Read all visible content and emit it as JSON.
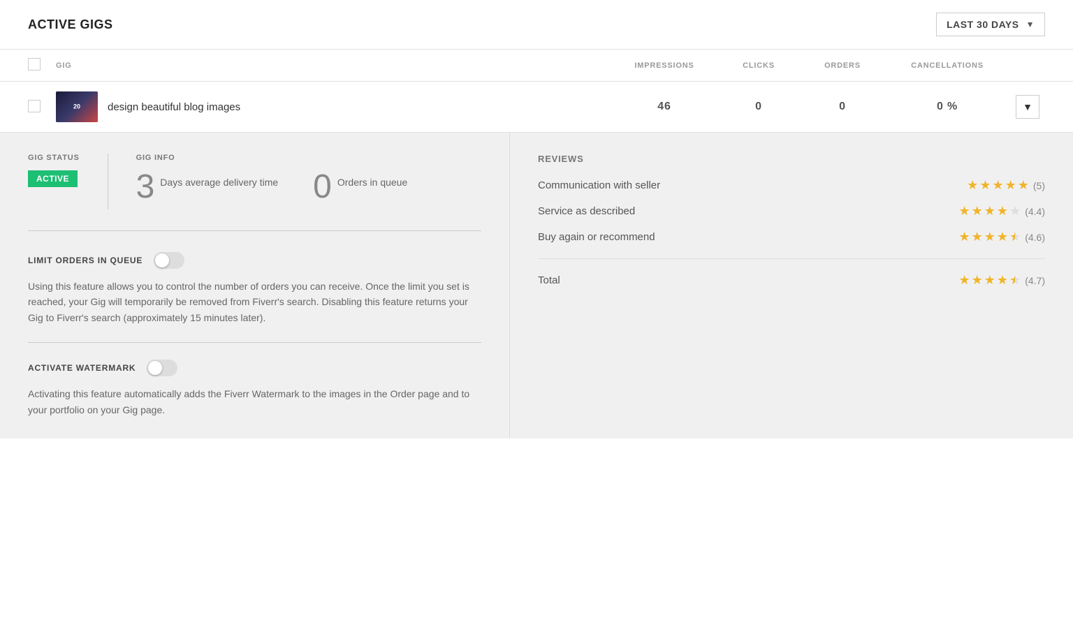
{
  "header": {
    "title": "ACTIVE GIGS",
    "dateFilter": "LAST 30 DAYS"
  },
  "table": {
    "columns": {
      "gig": "GIG",
      "impressions": "IMPRESSIONS",
      "clicks": "CLICKS",
      "orders": "ORDERS",
      "cancellations": "CANCELLATIONS"
    },
    "rows": [
      {
        "id": 1,
        "title": "design beautiful blog images",
        "impressions": "46",
        "clicks": "0",
        "orders": "0",
        "cancellations": "0 %"
      }
    ]
  },
  "detail": {
    "gigStatus": {
      "sectionLabel": "GIG STATUS",
      "statusBadge": "ACTIVE"
    },
    "gigInfo": {
      "sectionLabel": "GIG INFO",
      "deliveryNumber": "3",
      "deliveryDesc": "Days average delivery time",
      "ordersNumber": "0",
      "ordersDesc": "Orders in queue"
    },
    "limitOrders": {
      "label": "LIMIT ORDERS IN QUEUE",
      "description": "Using this feature allows you to control the number of orders you can receive. Once the limit you set is reached, your Gig will temporarily be removed from Fiverr's search. Disabling this feature returns your Gig to Fiverr's search (approximately 15 minutes later)."
    },
    "watermark": {
      "label": "ACTIVATE WATERMARK",
      "description": "Activating this feature automatically adds the Fiverr Watermark to the images in the Order page and to your portfolio on your Gig page."
    },
    "reviews": {
      "title": "REVIEWS",
      "items": [
        {
          "label": "Communication with seller",
          "rating": 5.0,
          "count": "(5)"
        },
        {
          "label": "Service as described",
          "rating": 4.4,
          "count": "(4.4)"
        },
        {
          "label": "Buy again or recommend",
          "rating": 4.6,
          "count": "(4.6)"
        }
      ],
      "total": {
        "label": "Total",
        "rating": 4.7,
        "count": "(4.7)"
      }
    }
  },
  "icons": {
    "chevronDown": "▼",
    "starFull": "★",
    "starHalf": "⯨"
  }
}
